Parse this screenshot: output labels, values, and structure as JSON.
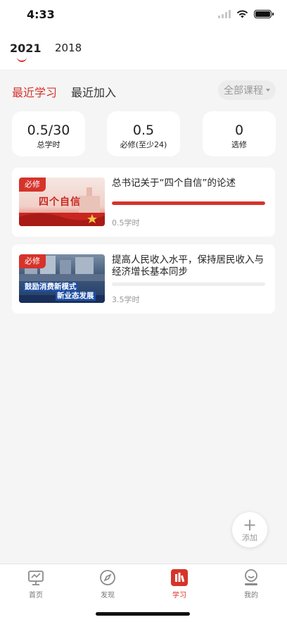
{
  "status_bar": {
    "time": "4:33"
  },
  "year_tabs": [
    {
      "label": "2021",
      "active": true
    },
    {
      "label": "2018",
      "active": false
    }
  ],
  "sub_tabs": [
    {
      "label": "最近学习",
      "active": true
    },
    {
      "label": "最近加入",
      "active": false
    }
  ],
  "filter": {
    "label": "全部课程"
  },
  "stats": [
    {
      "value": "0.5/30",
      "label": "总学时"
    },
    {
      "value": "0.5",
      "label": "必修(至少24)"
    },
    {
      "value": "0",
      "label": "选修"
    }
  ],
  "courses": [
    {
      "badge": "必修",
      "title": "总书记关于“四个自信”的论述",
      "progress": 1.0,
      "hours": "0.5学时",
      "thumb_text": "四个自信"
    },
    {
      "badge": "必修",
      "title": "提高人民收入水平，保持居民收入与经济增长基本同步",
      "progress": 0.0,
      "hours": "3.5学时",
      "thumb_text_1": "鼓励消费新模式",
      "thumb_text_2": "新业态发展"
    }
  ],
  "add_button": {
    "label": "添加"
  },
  "tabbar": [
    {
      "label": "首页",
      "icon": "monitor-icon",
      "active": false
    },
    {
      "label": "发现",
      "icon": "compass-icon",
      "active": false
    },
    {
      "label": "学习",
      "icon": "books-icon",
      "active": true
    },
    {
      "label": "我的",
      "icon": "person-icon",
      "active": false
    }
  ],
  "colors": {
    "accent": "#d6332a",
    "background": "#f5f5f5",
    "muted": "#999999"
  }
}
